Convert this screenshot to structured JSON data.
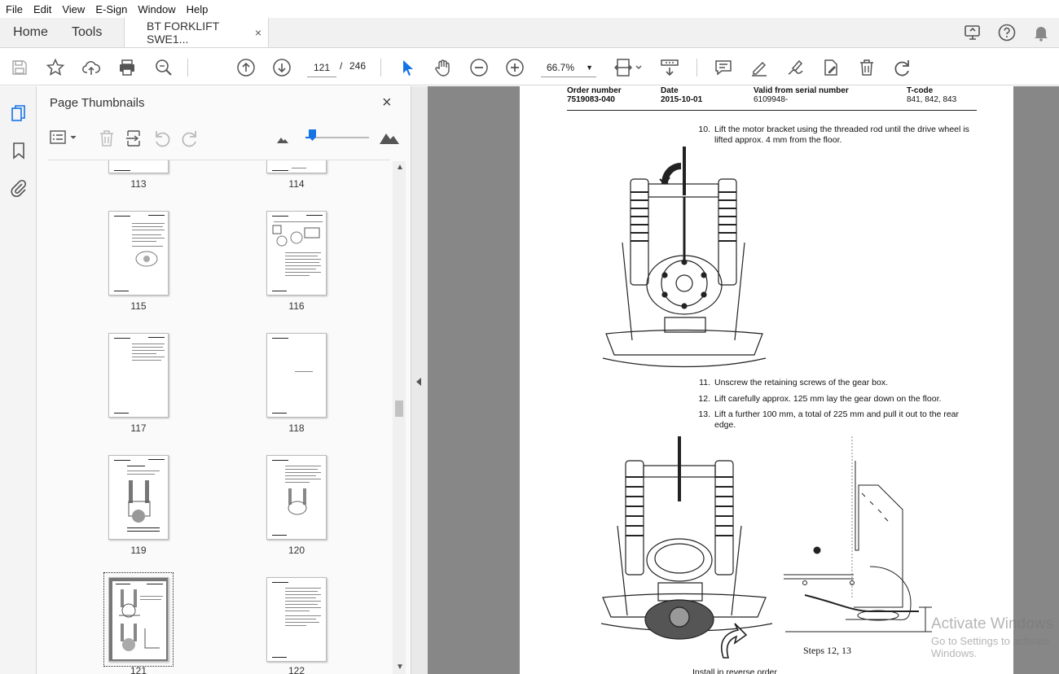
{
  "menu": {
    "items": [
      "File",
      "Edit",
      "View",
      "E-Sign",
      "Window",
      "Help"
    ]
  },
  "tabs": {
    "home": "Home",
    "tools": "Tools",
    "document": "BT FORKLIFT SWE1...",
    "close": "×"
  },
  "toolbar": {
    "current_page": "121",
    "separator": "/",
    "total_pages": "246",
    "zoom": "66.7%"
  },
  "panel": {
    "title": "Page Thumbnails",
    "close": "×",
    "thumbnails": [
      {
        "label": "113"
      },
      {
        "label": "114"
      },
      {
        "label": "115"
      },
      {
        "label": "116"
      },
      {
        "label": "117"
      },
      {
        "label": "118"
      },
      {
        "label": "119"
      },
      {
        "label": "120"
      },
      {
        "label": "121",
        "selected": true
      },
      {
        "label": "122"
      }
    ],
    "thumbnail_size_level": 0.1
  },
  "document": {
    "header": {
      "order_label": "Order number",
      "order_value": "7519083-040",
      "date_label": "Date",
      "date_value": "2015-10-01",
      "serial_label": "Valid from serial number",
      "serial_value": "6109948-",
      "tcode_label": "T-code",
      "tcode_value": "841, 842, 843"
    },
    "steps": [
      {
        "num": "10.",
        "text": "Lift the motor bracket using the threaded rod until the drive wheel is lifted approx. 4 mm from the floor."
      },
      {
        "num": "11.",
        "text": "Unscrew the retaining screws of the gear box."
      },
      {
        "num": "12.",
        "text": "Lift carefully approx. 125 mm lay the gear down on the floor."
      },
      {
        "num": "13.",
        "text": "Lift a further 100 mm, a total of 225 mm and pull it out to the rear edge."
      }
    ],
    "figure_caption": "Steps 12, 13",
    "footer_text": "Install in reverse order"
  },
  "watermark": {
    "line1": "Activate Windows",
    "line2": "Go to Settings to activate Windows."
  },
  "colors": {
    "accent": "#1473e6",
    "viewer_bg": "#878787",
    "panel_bg": "#fafafa"
  }
}
